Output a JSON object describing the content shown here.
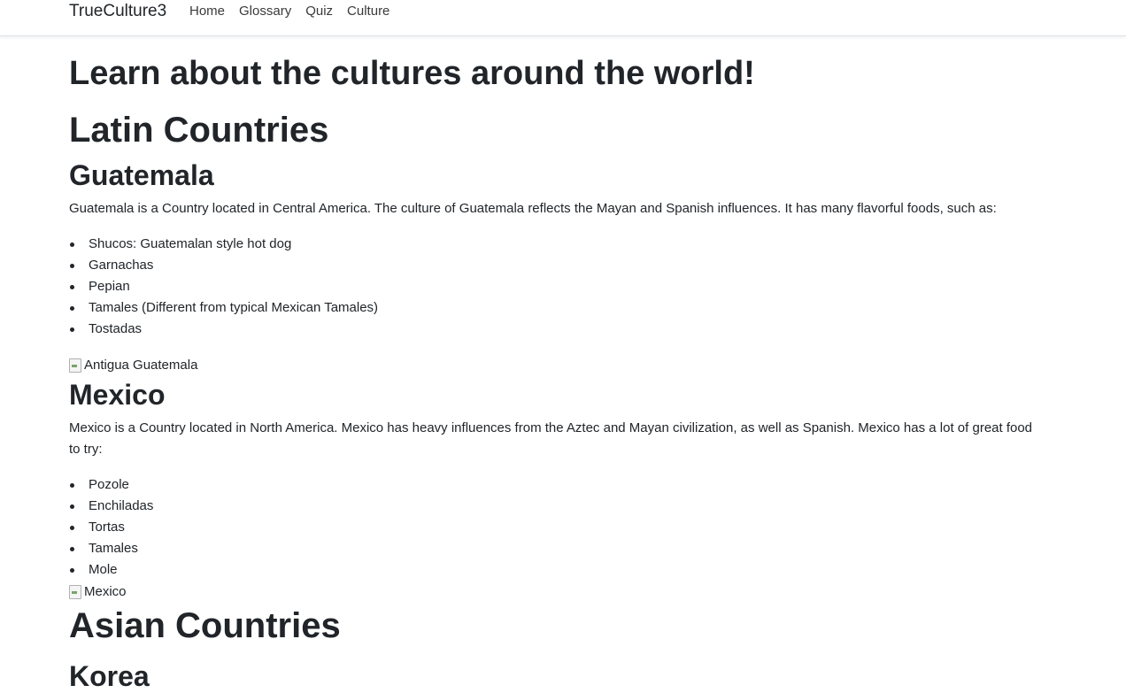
{
  "navbar": {
    "brand": "TrueCulture3",
    "links": [
      "Home",
      "Glossary",
      "Quiz",
      "Culture"
    ]
  },
  "page": {
    "heading": "Learn about the cultures around the world!"
  },
  "latin": {
    "title": "Latin Countries",
    "guatemala": {
      "title": "Guatemala",
      "description": "Guatemala is a Country located in Central America. The culture of Guatemala reflects the Mayan and Spanish influences. It has many flavorful foods, such as:",
      "foods": [
        "Shucos: Guatemalan style hot dog",
        "Garnachas",
        "Pepian",
        "Tamales (Different from typical Mexican Tamales)",
        "Tostadas"
      ],
      "image_alt": "Antigua Guatemala"
    },
    "mexico": {
      "title": "Mexico",
      "description": "Mexico is a Country located in North America. Mexico has heavy influences from the Aztec and Mayan civilization, as well as Spanish. Mexico has a lot of great food to try:",
      "foods": [
        "Pozole",
        "Enchiladas",
        "Tortas",
        "Tamales",
        "Mole"
      ],
      "image_alt": "Mexico"
    }
  },
  "asian": {
    "title": "Asian Countries",
    "korea": {
      "title": "Korea"
    }
  }
}
